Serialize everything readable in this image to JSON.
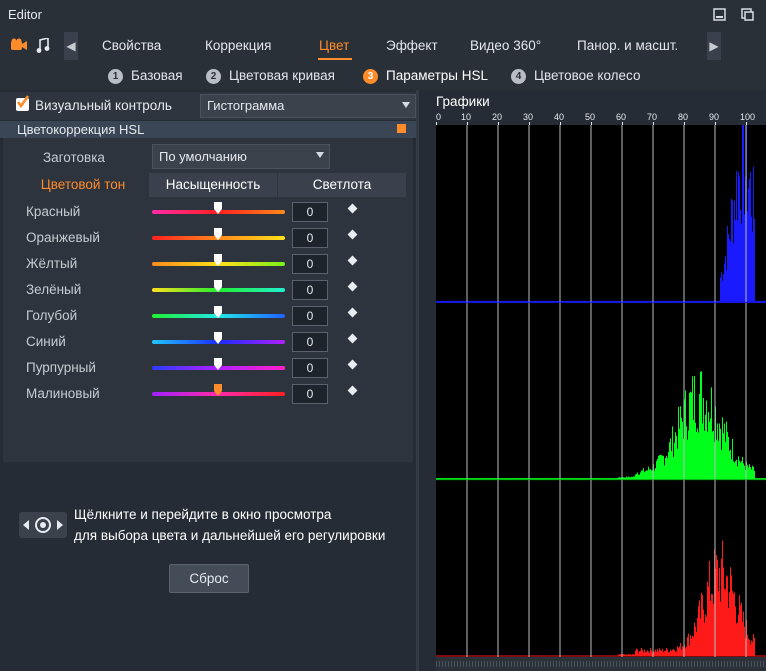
{
  "window": {
    "title": "Editor"
  },
  "toolbar_icons": [
    "video-icon",
    "music-icon"
  ],
  "main_tabs": [
    {
      "label": "Свойства",
      "active": false
    },
    {
      "label": "Коррекция",
      "active": false
    },
    {
      "label": "Цвет",
      "active": true
    },
    {
      "label": "Эффект",
      "active": false
    },
    {
      "label": "Видео 360°",
      "active": false
    },
    {
      "label": "Панор. и масшт.",
      "active": false
    }
  ],
  "sub_tabs": [
    {
      "num": "1",
      "label": "Базовая",
      "active": false
    },
    {
      "num": "2",
      "label": "Цветовая кривая",
      "active": false
    },
    {
      "num": "3",
      "label": "Параметры HSL",
      "active": true
    },
    {
      "num": "4",
      "label": "Цветовое колесо",
      "active": false
    }
  ],
  "visual_control": {
    "label": "Визуальный контроль",
    "checked": true,
    "mode": "Гистограмма"
  },
  "hsl": {
    "title": "Цветокоррекция HSL",
    "preset_label": "Заготовка",
    "preset_value": "По умолчанию",
    "tabs": [
      {
        "label": "Цветовой тон",
        "active": true
      },
      {
        "label": "Насыщенность",
        "active": false
      },
      {
        "label": "Светлота",
        "active": false
      }
    ],
    "colors": [
      {
        "label": "Красный",
        "value": "0",
        "thumb": "#ffffff",
        "gradient": "linear-gradient(to right,#ff2aa8,#ff2020,#ff8a1a)"
      },
      {
        "label": "Оранжевый",
        "value": "0",
        "thumb": "#ffffff",
        "gradient": "linear-gradient(to right,#ff2020,#ff8a1a,#ffe01a)"
      },
      {
        "label": "Жёлтый",
        "value": "0",
        "thumb": "#ffffff",
        "gradient": "linear-gradient(to right,#ff8a1a,#ffe01a,#7cf01a)"
      },
      {
        "label": "Зелёный",
        "value": "0",
        "thumb": "#ffffff",
        "gradient": "linear-gradient(to right,#ffe01a,#20f030,#20f0d0)"
      },
      {
        "label": "Голубой",
        "value": "0",
        "thumb": "#ffffff",
        "gradient": "linear-gradient(to right,#20f030,#20e8e8,#2060ff)"
      },
      {
        "label": "Синий",
        "value": "0",
        "thumb": "#ffffff",
        "gradient": "linear-gradient(to right,#20c8ff,#1a2cff,#b020ff)"
      },
      {
        "label": "Пурпурный",
        "value": "0",
        "thumb": "#ffffff",
        "gradient": "linear-gradient(to right,#2a3cff,#b020ff,#ff20c8)"
      },
      {
        "label": "Малиновый",
        "value": "0",
        "thumb": "#ff8c2a",
        "gradient": "linear-gradient(to right,#a020ff,#ff2aa8,#ff2020)"
      }
    ],
    "hint_line1": "Щёлкните и перейдите в окно просмотра",
    "hint_line2": "для выбора цвета и дальнейшей его регулировки",
    "reset_label": "Сброс"
  },
  "graphs": {
    "title": "Графики",
    "ticks": [
      "0",
      "10",
      "20",
      "30",
      "40",
      "50",
      "60",
      "70",
      "80",
      "90",
      "100"
    ]
  },
  "colors": {
    "accent": "#ff8c2a",
    "panel": "#2e343d",
    "background": "#1f252d"
  }
}
